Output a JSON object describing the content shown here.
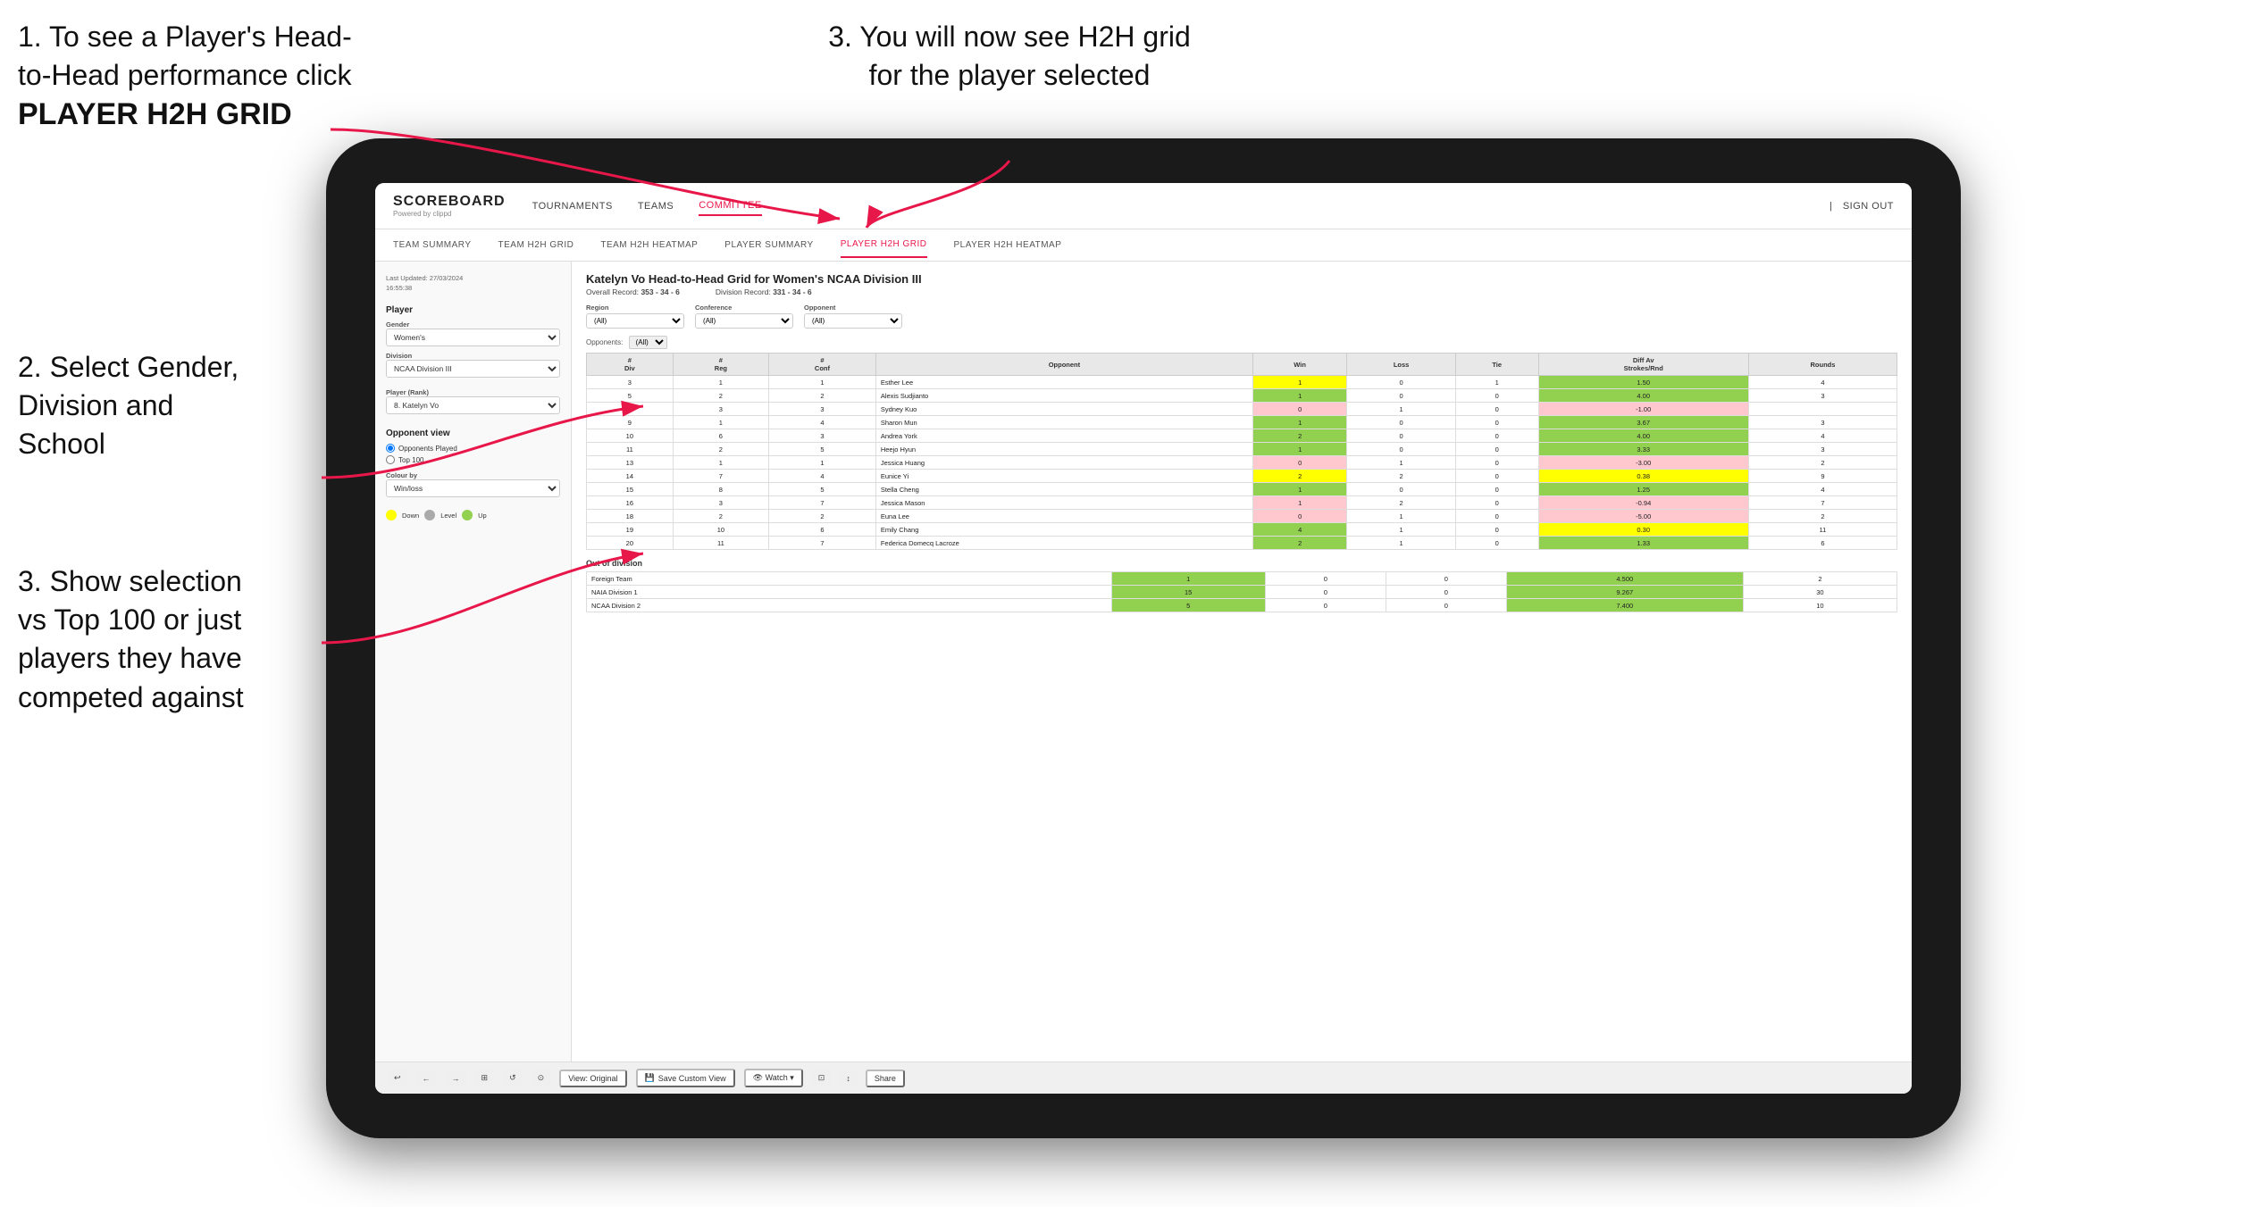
{
  "instructions": {
    "top_left_line1": "1. To see a Player's Head-",
    "top_left_line2": "to-Head performance click",
    "top_left_bold": "PLAYER H2H GRID",
    "top_right": "3. You will now see H2H grid\nfor the player selected",
    "mid_left_title": "2. Select Gender,\nDivision and\nSchool",
    "bottom_left": "3. Show selection\nvs Top 100 or just\nplayers they have\ncompeted against"
  },
  "nav": {
    "logo": "SCOREBOARD",
    "logo_sub": "Powered by clippd",
    "links": [
      "TOURNAMENTS",
      "TEAMS",
      "COMMITTEE"
    ],
    "active_link": "COMMITTEE",
    "sign_out": "Sign out"
  },
  "sub_nav": {
    "links": [
      "TEAM SUMMARY",
      "TEAM H2H GRID",
      "TEAM H2H HEATMAP",
      "PLAYER SUMMARY",
      "PLAYER H2H GRID",
      "PLAYER H2H HEATMAP"
    ],
    "active": "PLAYER H2H GRID"
  },
  "sidebar": {
    "timestamp_label": "Last Updated: 27/03/2024",
    "timestamp_time": "16:55:38",
    "player_label": "Player",
    "gender_label": "Gender",
    "gender_value": "Women's",
    "division_label": "Division",
    "division_value": "NCAA Division III",
    "player_rank_label": "Player (Rank)",
    "player_rank_value": "8. Katelyn Vo",
    "opponent_view_label": "Opponent view",
    "radio_opponents": "Opponents Played",
    "radio_top100": "Top 100",
    "colour_by_label": "Colour by",
    "colour_by_value": "Win/loss",
    "legend_down": "Down",
    "legend_level": "Level",
    "legend_up": "Up"
  },
  "chart": {
    "title": "Katelyn Vo Head-to-Head Grid for Women's NCAA Division III",
    "overall_record_label": "Overall Record:",
    "overall_record_value": "353 - 34 - 6",
    "division_record_label": "Division Record:",
    "division_record_value": "331 - 34 - 6",
    "filter_opponents_label": "Opponents:",
    "filter_region_label": "Region",
    "filter_conference_label": "Conference",
    "filter_opponent_label": "Opponent",
    "filter_all": "(All)",
    "table_headers": [
      "#\nDiv",
      "#\nReg",
      "#\nConf",
      "Opponent",
      "Win",
      "Loss",
      "Tie",
      "Diff Av\nStrokes/Rnd",
      "Rounds"
    ],
    "rows": [
      {
        "div": 3,
        "reg": 1,
        "conf": 1,
        "opponent": "Esther Lee",
        "win": 1,
        "loss": 0,
        "tie": 1,
        "diff": 1.5,
        "rounds": 4,
        "win_color": "yellow",
        "diff_color": "green"
      },
      {
        "div": 5,
        "reg": 2,
        "conf": 2,
        "opponent": "Alexis Sudjianto",
        "win": 1,
        "loss": 0,
        "tie": 0,
        "diff": 4.0,
        "rounds": 3,
        "win_color": "green",
        "diff_color": "green"
      },
      {
        "div": 6,
        "reg": 3,
        "conf": 3,
        "opponent": "Sydney Kuo",
        "win": 0,
        "loss": 1,
        "tie": 0,
        "diff": -1.0,
        "rounds": "",
        "win_color": "red",
        "diff_color": "red"
      },
      {
        "div": 9,
        "reg": 1,
        "conf": 4,
        "opponent": "Sharon Mun",
        "win": 1,
        "loss": 0,
        "tie": 0,
        "diff": 3.67,
        "rounds": 3,
        "win_color": "green",
        "diff_color": "green"
      },
      {
        "div": 10,
        "reg": 6,
        "conf": 3,
        "opponent": "Andrea York",
        "win": 2,
        "loss": 0,
        "tie": 0,
        "diff": 4.0,
        "rounds": 4,
        "win_color": "green",
        "diff_color": "green"
      },
      {
        "div": 11,
        "reg": 2,
        "conf": 5,
        "opponent": "Heejo Hyun",
        "win": 1,
        "loss": 0,
        "tie": 0,
        "diff": 3.33,
        "rounds": 3,
        "win_color": "green",
        "diff_color": "green"
      },
      {
        "div": 13,
        "reg": 1,
        "conf": 1,
        "opponent": "Jessica Huang",
        "win": 0,
        "loss": 1,
        "tie": 0,
        "diff": -3.0,
        "rounds": 2,
        "win_color": "red",
        "diff_color": "red"
      },
      {
        "div": 14,
        "reg": 7,
        "conf": 4,
        "opponent": "Eunice Yi",
        "win": 2,
        "loss": 2,
        "tie": 0,
        "diff": 0.38,
        "rounds": 9,
        "win_color": "yellow",
        "diff_color": "yellow"
      },
      {
        "div": 15,
        "reg": 8,
        "conf": 5,
        "opponent": "Stella Cheng",
        "win": 1,
        "loss": 0,
        "tie": 0,
        "diff": 1.25,
        "rounds": 4,
        "win_color": "green",
        "diff_color": "green"
      },
      {
        "div": 16,
        "reg": 3,
        "conf": 7,
        "opponent": "Jessica Mason",
        "win": 1,
        "loss": 2,
        "tie": 0,
        "diff": -0.94,
        "rounds": 7,
        "win_color": "red",
        "diff_color": "red"
      },
      {
        "div": 18,
        "reg": 2,
        "conf": 2,
        "opponent": "Euna Lee",
        "win": 0,
        "loss": 1,
        "tie": 0,
        "diff": -5.0,
        "rounds": 2,
        "win_color": "red",
        "diff_color": "red"
      },
      {
        "div": 19,
        "reg": 10,
        "conf": 6,
        "opponent": "Emily Chang",
        "win": 4,
        "loss": 1,
        "tie": 0,
        "diff": 0.3,
        "rounds": 11,
        "win_color": "green",
        "diff_color": "yellow"
      },
      {
        "div": 20,
        "reg": 11,
        "conf": 7,
        "opponent": "Federica Domecq Lacroze",
        "win": 2,
        "loss": 1,
        "tie": 0,
        "diff": 1.33,
        "rounds": 6,
        "win_color": "green",
        "diff_color": "green"
      }
    ],
    "out_of_division_label": "Out of division",
    "out_of_division_rows": [
      {
        "label": "Foreign Team",
        "win": 1,
        "loss": 0,
        "tie": 0,
        "diff": 4.5,
        "rounds": 2
      },
      {
        "label": "NAIA Division 1",
        "win": 15,
        "loss": 0,
        "tie": 0,
        "diff": 9.267,
        "rounds": 30
      },
      {
        "label": "NCAA Division 2",
        "win": 5,
        "loss": 0,
        "tie": 0,
        "diff": 7.4,
        "rounds": 10
      }
    ]
  },
  "toolbar": {
    "buttons": [
      "↩",
      "←",
      "→",
      "⊞",
      "↺",
      "⊙",
      "View: Original",
      "Save Custom View",
      "👁 Watch ▾",
      "⊡",
      "↕",
      "Share"
    ]
  },
  "colors": {
    "accent": "#e8174a",
    "green_strong": "#92d050",
    "green_light": "#c6efce",
    "yellow": "#ffff00",
    "red_light": "#ffc7ce",
    "red_strong": "#ff6666"
  }
}
